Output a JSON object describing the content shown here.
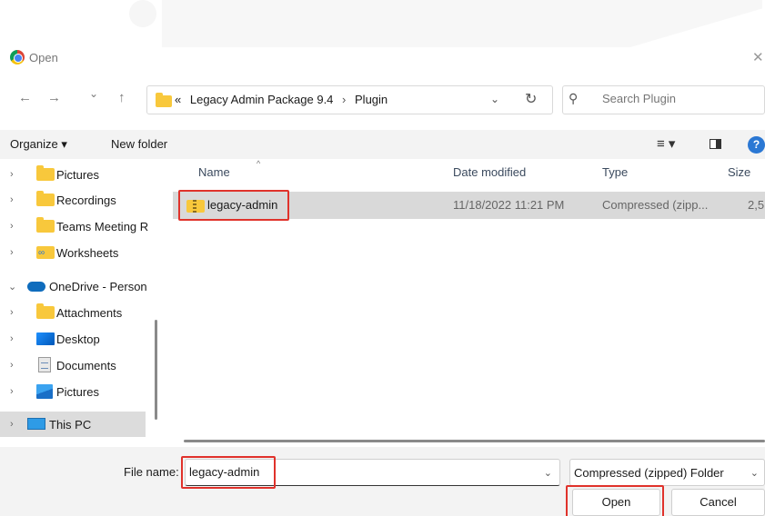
{
  "window": {
    "title": "Open",
    "close_glyph": "✕"
  },
  "nav": {
    "back_glyph": "←",
    "forward_glyph": "→",
    "recent_glyph": "⌄",
    "up_glyph": "↑",
    "breadcrumb_prefix": "«",
    "breadcrumbs": [
      "Legacy Admin Package 9.4",
      "Plugin"
    ],
    "breadcrumb_sep": "›",
    "address_dropdown_glyph": "⌄",
    "refresh_glyph": "↻",
    "search_placeholder": "Search Plugin",
    "search_glyph": "⚲"
  },
  "toolbar": {
    "organize_label": "Organize ▾",
    "new_folder_label": "New folder",
    "view_glyph": "≡ ▾",
    "help_glyph": "?"
  },
  "sidebar": {
    "items": [
      {
        "label": "Pictures",
        "chev": "›",
        "icon": "folder-icon"
      },
      {
        "label": "Recordings",
        "chev": "›",
        "icon": "folder-icon"
      },
      {
        "label": "Teams Meeting R",
        "chev": "›",
        "icon": "folder-icon"
      },
      {
        "label": "Worksheets",
        "chev": "›",
        "icon": "shared-folder-icon"
      },
      {
        "label": "OneDrive - Person",
        "chev": "⌄",
        "icon": "onedrive-cloud-icon"
      },
      {
        "label": "Attachments",
        "chev": "›",
        "icon": "folder-icon"
      },
      {
        "label": "Desktop",
        "chev": "›",
        "icon": "desktop-icon"
      },
      {
        "label": "Documents",
        "chev": "›",
        "icon": "documents-icon"
      },
      {
        "label": "Pictures",
        "chev": "›",
        "icon": "pictures-icon"
      },
      {
        "label": "This PC",
        "chev": "›",
        "icon": "computer-icon"
      }
    ]
  },
  "filelist": {
    "columns": [
      "Name",
      "Date modified",
      "Type",
      "Size"
    ],
    "sort_glyph": "^",
    "rows": [
      {
        "name": "legacy-admin",
        "date": "11/18/2022 11:21 PM",
        "type": "Compressed (zipp...",
        "size": "2,5"
      }
    ]
  },
  "footer": {
    "file_name_label": "File name:",
    "file_name_value": "legacy-admin",
    "file_name_dropdown_glyph": "⌄",
    "file_type_value": "Compressed (zipped) Folder",
    "file_type_dropdown_glyph": "⌄",
    "open_label": "Open",
    "cancel_label": "Cancel"
  },
  "colors": {
    "highlight_box": "#e0322b",
    "selection": "#d9d9d9",
    "accent": "#2b78d4"
  }
}
